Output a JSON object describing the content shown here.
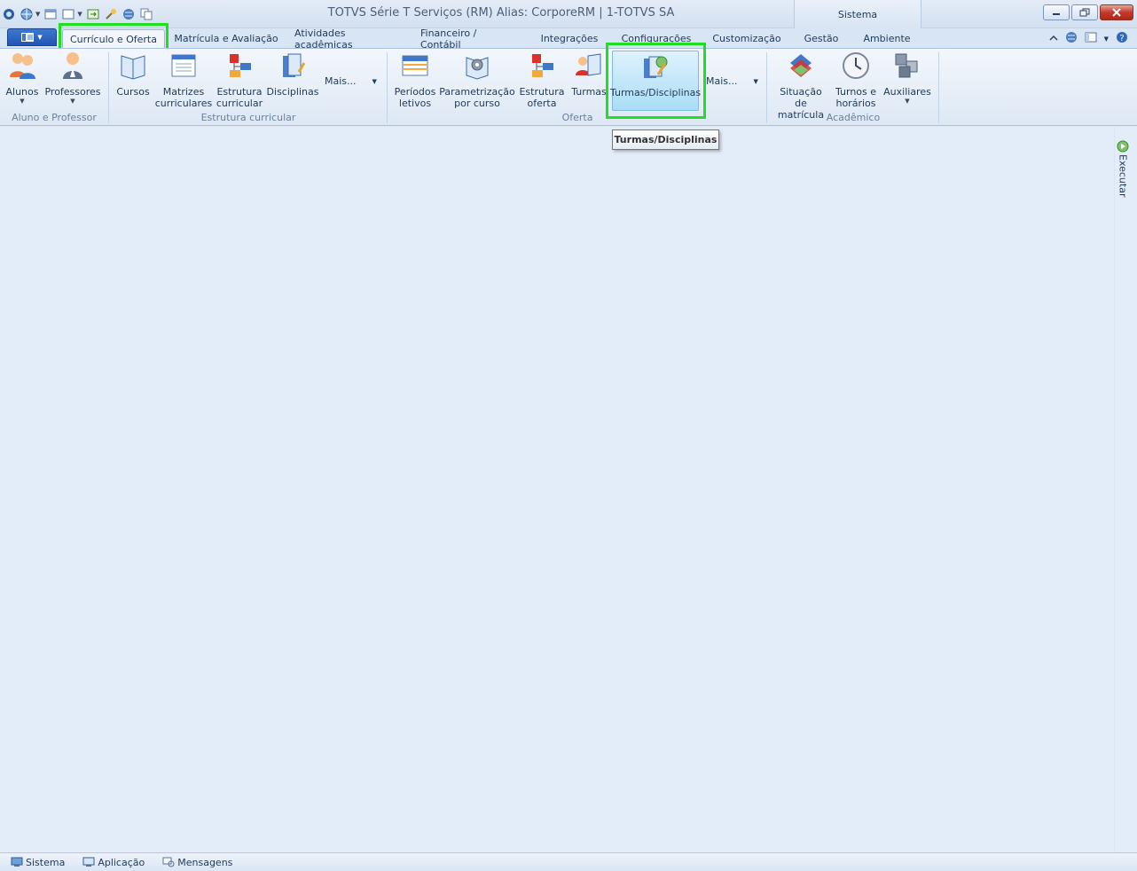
{
  "window": {
    "title": "TOTVS Série T Serviços (RM) Alias: CorporeRM | 1-TOTVS SA",
    "context_tab": "Sistema"
  },
  "tabs": [
    {
      "label": "Currículo e Oferta"
    },
    {
      "label": "Matrícula e Avaliação"
    },
    {
      "label": "Atividades acadêmicas"
    },
    {
      "label": "Financeiro / Contábil"
    },
    {
      "label": "Integrações"
    },
    {
      "label": "Configurações"
    },
    {
      "label": "Customização"
    },
    {
      "label": "Gestão"
    },
    {
      "label": "Ambiente"
    }
  ],
  "ribbon": {
    "groups": [
      {
        "label": "Aluno e Professor"
      },
      {
        "label": "Estrutura curricular"
      },
      {
        "label": "Oferta"
      },
      {
        "label": "Acadêmico"
      }
    ],
    "buttons": {
      "alunos": "Alunos",
      "professores": "Professores",
      "cursos": "Cursos",
      "matrizes_1": "Matrizes",
      "matrizes_2": "curriculares",
      "estrutura_1": "Estrutura",
      "estrutura_2": "curricular",
      "disciplinas": "Disciplinas",
      "mais": "Mais...",
      "periodos_1": "Períodos",
      "periodos_2": "letivos",
      "param_1": "Parametrização",
      "param_2": "por curso",
      "oferta_1": "Estrutura",
      "oferta_2": "oferta",
      "turmas": "Turmas",
      "turmas_disciplinas": "Turmas/Disciplinas",
      "situacao_1": "Situação de",
      "situacao_2": "matrícula",
      "turnos_1": "Turnos e",
      "turnos_2": "horários",
      "auxiliares": "Auxiliares"
    }
  },
  "tooltip": "Turmas/Disciplinas",
  "side_panel": {
    "label": "Executar"
  },
  "statusbar": [
    {
      "label": "Sistema"
    },
    {
      "label": "Aplicação"
    },
    {
      "label": "Mensagens"
    }
  ],
  "colors": {
    "highlight": "#1fe01f",
    "accent": "#1f56b5",
    "workspace": "#e3ecf9"
  }
}
